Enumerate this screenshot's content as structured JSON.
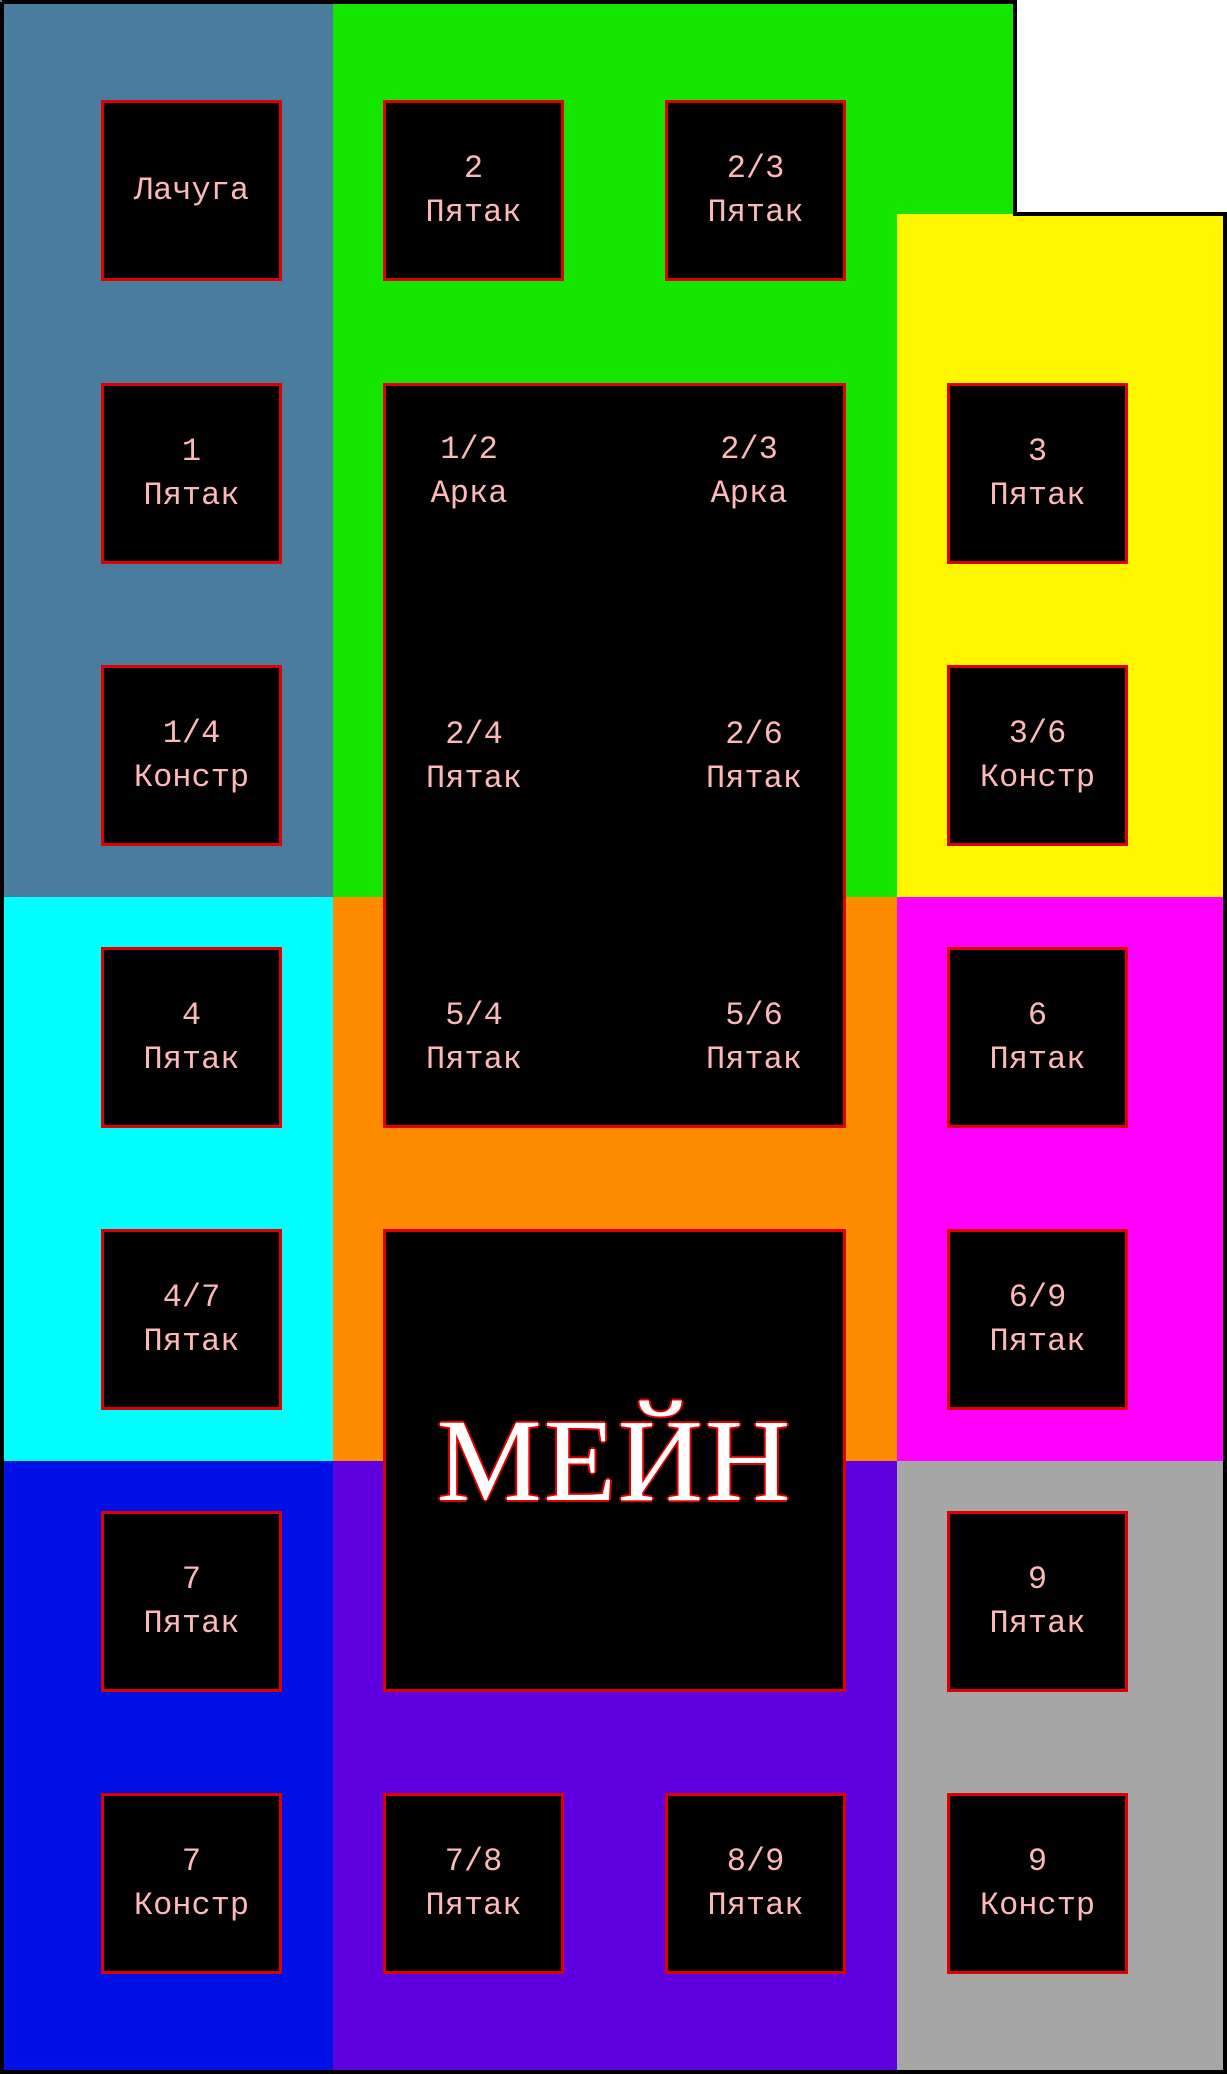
{
  "colors": {
    "gray_blue": "#4a7c9e",
    "green": "#14e600",
    "yellow": "#fff700",
    "cyan": "#00ffff",
    "orange": "#ff8c00",
    "magenta": "#ff00ff",
    "blue": "#0010e6",
    "purple": "#5e00e0",
    "gray": "#a6a6a6",
    "tile_border": "#e00000",
    "tile_text": "#ffb8b8"
  },
  "tiles": {
    "shack": {
      "line1": "Лачуга",
      "line2": ""
    },
    "t2": {
      "line1": "2",
      "line2": "Пятак"
    },
    "t2_3_top": {
      "line1": "2/3",
      "line2": "Пятак"
    },
    "t1": {
      "line1": "1",
      "line2": "Пятак"
    },
    "t3": {
      "line1": "3",
      "line2": "Пятак"
    },
    "t1_4": {
      "line1": "1/4",
      "line2": "Констр"
    },
    "t3_6": {
      "line1": "3/6",
      "line2": "Констр"
    },
    "t4": {
      "line1": "4",
      "line2": "Пятак"
    },
    "t6": {
      "line1": "6",
      "line2": "Пятак"
    },
    "t4_7": {
      "line1": "4/7",
      "line2": "Пятак"
    },
    "t6_9": {
      "line1": "6/9",
      "line2": "Пятак"
    },
    "t7": {
      "line1": "7",
      "line2": "Пятак"
    },
    "t9": {
      "line1": "9",
      "line2": "Пятак"
    },
    "t7_c": {
      "line1": "7",
      "line2": "Констр"
    },
    "t7_8": {
      "line1": "7/8",
      "line2": "Пятак"
    },
    "t8_9": {
      "line1": "8/9",
      "line2": "Пятак"
    },
    "t9_c": {
      "line1": "9",
      "line2": "Констр"
    }
  },
  "center": {
    "a1_2": {
      "line1": "1/2",
      "line2": "Арка"
    },
    "a2_3": {
      "line1": "2/3",
      "line2": "Арка"
    },
    "p2_4": {
      "line1": "2/4",
      "line2": "Пятак"
    },
    "p2_6": {
      "line1": "2/6",
      "line2": "Пятак"
    },
    "p5_4": {
      "line1": "5/4",
      "line2": "Пятак"
    },
    "p5_6": {
      "line1": "5/6",
      "line2": "Пятак"
    }
  },
  "main_label": "МЕЙН"
}
